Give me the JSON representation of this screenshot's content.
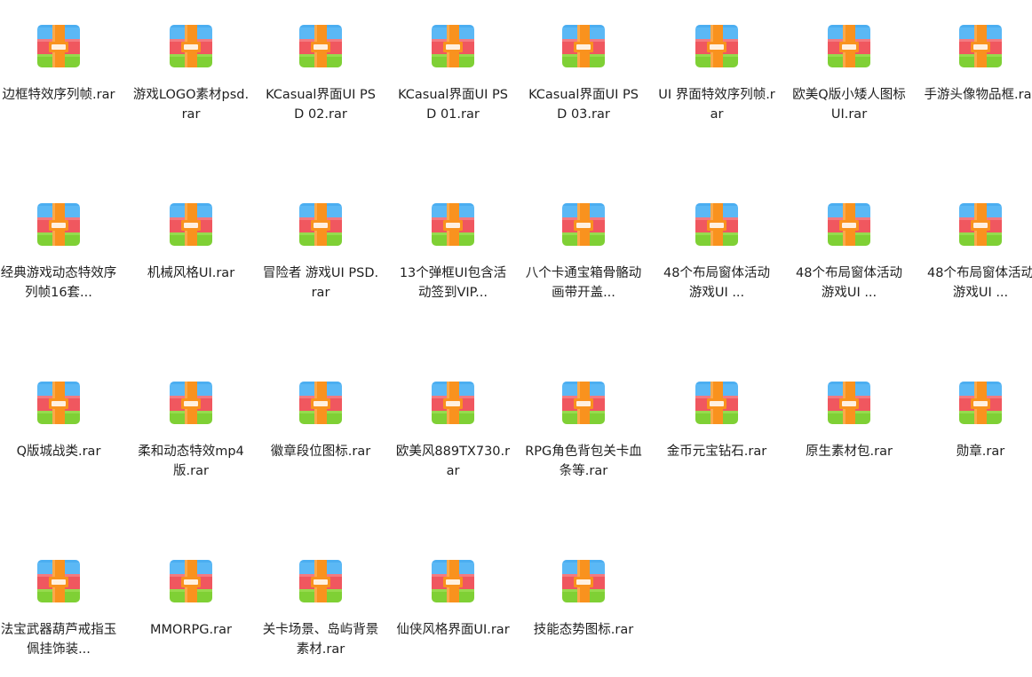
{
  "window": {
    "title": ""
  },
  "icon": {
    "name": "rar-archive-icon",
    "colors": {
      "top": "#5BB8F5",
      "top_dark": "#2E9CEC",
      "middle": "#F0575F",
      "middle_light": "#F47A80",
      "bottom": "#7FD035",
      "bottom_light": "#96DB4E",
      "strap": "#F9921E",
      "strap_light": "#FCA94A",
      "buckle": "#FFF0E0"
    }
  },
  "files": [
    {
      "label": "边框特效序列帧.rar"
    },
    {
      "label": "游戏LOGO素材psd.rar"
    },
    {
      "label": "KCasual界面UI PSD 02.rar"
    },
    {
      "label": "KCasual界面UI PSD 01.rar"
    },
    {
      "label": "KCasual界面UI PSD 03.rar"
    },
    {
      "label": "UI 界面特效序列帧.rar"
    },
    {
      "label": "欧美Q版小矮人图标UI.rar"
    },
    {
      "label": "手游头像物品框.rar"
    },
    {
      "label": "经典游戏动态特效序列帧16套..."
    },
    {
      "label": "机械风格UI.rar"
    },
    {
      "label": "冒险者 游戏UI PSD.rar"
    },
    {
      "label": "13个弹框UI包含活动签到VIP..."
    },
    {
      "label": "八个卡通宝箱骨骼动画带开盖..."
    },
    {
      "label": "48个布局窗体活动 游戏UI ..."
    },
    {
      "label": "48个布局窗体活动 游戏UI ..."
    },
    {
      "label": "48个布局窗体活动 游戏UI ..."
    },
    {
      "label": "Q版城战类.rar"
    },
    {
      "label": "柔和动态特效mp4版.rar"
    },
    {
      "label": "徽章段位图标.rar"
    },
    {
      "label": "欧美风889TX730.rar"
    },
    {
      "label": "RPG角色背包关卡血条等.rar"
    },
    {
      "label": "金币元宝钻石.rar"
    },
    {
      "label": "原生素材包.rar"
    },
    {
      "label": "勋章.rar"
    },
    {
      "label": "法宝武器葫芦戒指玉佩挂饰装..."
    },
    {
      "label": "MMORPG.rar"
    },
    {
      "label": "关卡场景、岛屿背景素材.rar"
    },
    {
      "label": "仙侠风格界面UI.rar"
    },
    {
      "label": "技能态势图标.rar"
    }
  ]
}
